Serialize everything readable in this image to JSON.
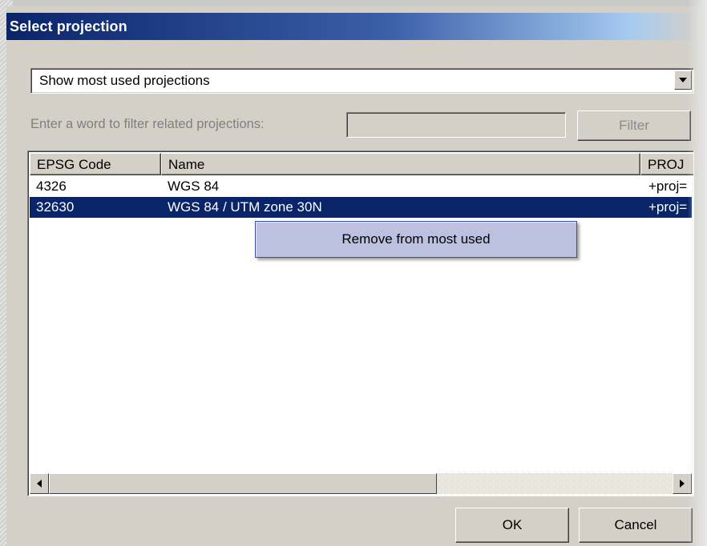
{
  "window": {
    "title": "Select projection"
  },
  "projection_filter": {
    "selected_option": "Show most used projections"
  },
  "filter_row": {
    "label": "Enter a word to filter related projections:",
    "input_value": "",
    "button_label": "Filter"
  },
  "projection_list": {
    "columns": [
      "EPSG Code",
      "Name",
      "PROJ"
    ],
    "rows": [
      {
        "code": "4326",
        "name": "WGS 84",
        "proj": "+proj=",
        "selected": false
      },
      {
        "code": "32630",
        "name": "WGS 84 / UTM zone 30N",
        "proj": "+proj=",
        "selected": true
      }
    ]
  },
  "context_menu": {
    "items": [
      "Remove from most used"
    ]
  },
  "buttons": {
    "ok": "OK",
    "cancel": "Cancel"
  },
  "colors": {
    "title_bar_start": "#0a246a",
    "selection": "#0a246a",
    "context_menu_bg": "#bcc1e0",
    "dialog_bg": "#d4d0c8"
  }
}
